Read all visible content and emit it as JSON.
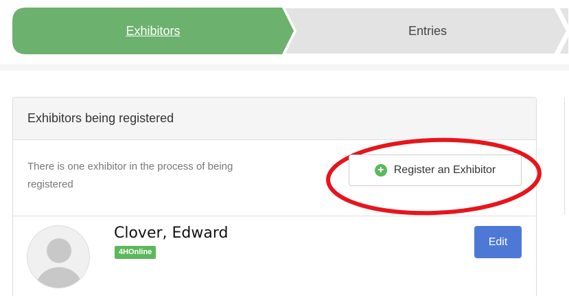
{
  "wizard": {
    "steps": [
      {
        "label": "Exhibitors",
        "active": true
      },
      {
        "label": "Entries",
        "active": false
      }
    ],
    "active_color": "#6cb16e",
    "inactive_color": "#e3e3e3"
  },
  "panel": {
    "heading": "Exhibitors being registered",
    "info_text": "There is one exhibitor in the process of being registered",
    "register_button_label": "Register an Exhibitor",
    "register_icon": "plus-circle-icon",
    "highlight_color": "#e8141c"
  },
  "exhibitors": [
    {
      "name": "Clover, Edward",
      "badge": "4HOnline",
      "edit_label": "Edit",
      "avatar_icon": "user-avatar-placeholder-icon"
    }
  ]
}
